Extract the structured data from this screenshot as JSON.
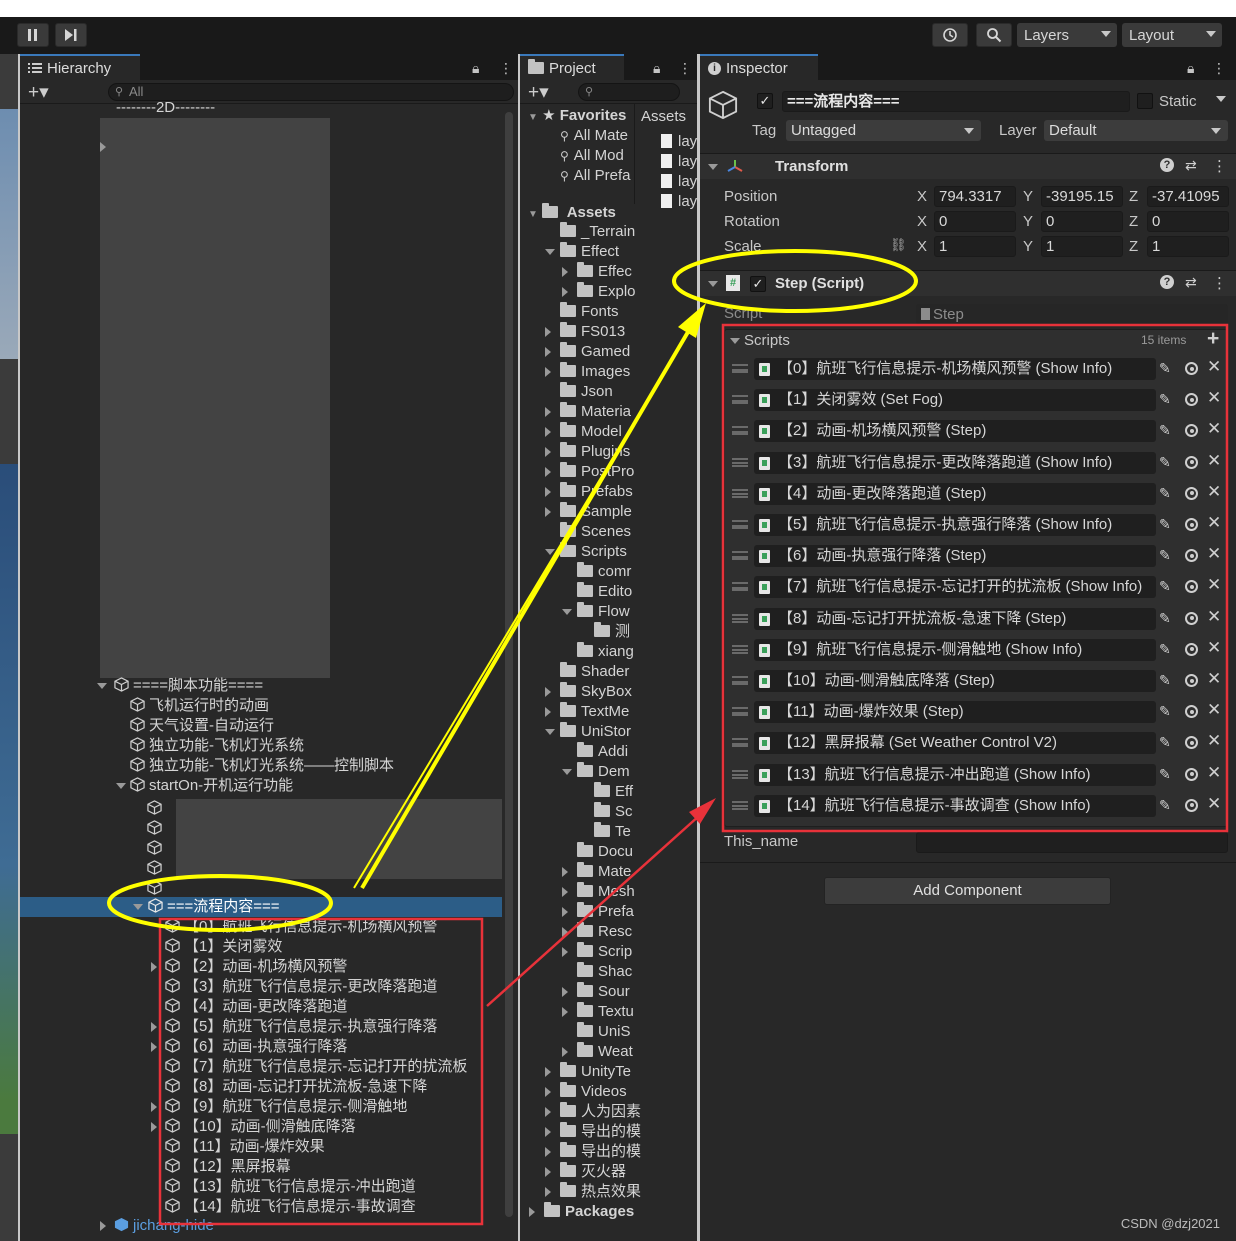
{
  "toolbar": {
    "layers_label": "Layers",
    "layout_label": "Layout"
  },
  "hierarchy": {
    "tab_label": "Hierarchy",
    "search_placeholder": "All",
    "top_row": "--------2D--------",
    "function_group": "====脚本功能====",
    "function_items": [
      "飞机运行时的动画",
      "天气设置-自动运行",
      "独立功能-飞机灯光系统",
      "独立功能-飞机灯光系统——控制脚本",
      "startOn-开机运行功能"
    ],
    "selected": "===流程内容===",
    "flow_children": [
      "【0】航班飞行信息提示-机场横风预警",
      "【1】关闭雾效",
      "【2】动画-机场横风预警",
      "【3】航班飞行信息提示-更改降落跑道",
      "【4】动画-更改降落跑道",
      "【5】航班飞行信息提示-执意强行降落",
      "【6】动画-执意强行降落",
      "【7】航班飞行信息提示-忘记打开的扰流板",
      "【8】动画-忘记打开扰流板-急速下降",
      "【9】航班飞行信息提示-侧滑触地",
      "【10】动画-侧滑触底降落",
      "【11】动画-爆炸效果",
      "【12】黑屏报幕",
      "【13】航班飞行信息提示-冲出跑道",
      "【14】航班飞行信息提示-事故调查"
    ],
    "bottom_item": "jichang-hide"
  },
  "project": {
    "tab_label": "Project",
    "favorites_label": "Favorites",
    "favorites": [
      "All Mate",
      "All Mod",
      "All Prefa"
    ],
    "assets_header": "Assets",
    "asset_files": [
      "lay",
      "lay",
      "lay",
      "lay"
    ],
    "assets_label": "Assets",
    "tree": [
      "_Terrain",
      "Effect",
      "Effec",
      "Explo",
      "Fonts",
      "FS013",
      "Gamed",
      "Images",
      "Json",
      "Materia",
      "Model",
      "Plugins",
      "PostPro",
      "Prefabs",
      "Sample",
      "Scenes",
      "Scripts",
      "comr",
      "Edito",
      "Flow",
      "测",
      "xiang",
      "Shader",
      "SkyBox",
      "TextMe",
      "UniStor",
      "Addi",
      "Dem",
      "Eff",
      "Sc",
      "Te",
      "Docu",
      "Mate",
      "Mesh",
      "Prefa",
      "Resc",
      "Scrip",
      "Shac",
      "Sour",
      "Textu",
      "UniS",
      "Weat",
      "UnityTe",
      "Videos",
      "人为因素",
      "导出的模",
      "导出的模",
      "灭火器",
      "热点效果",
      "Packages"
    ]
  },
  "inspector": {
    "tab_label": "Inspector",
    "object_name": "===流程内容===",
    "static_label": "Static",
    "tag_label": "Tag",
    "tag_value": "Untagged",
    "layer_label": "Layer",
    "layer_value": "Default",
    "transform": {
      "title": "Transform",
      "position_label": "Position",
      "rotation_label": "Rotation",
      "scale_label": "Scale",
      "position": {
        "x": "794.3317",
        "y": "-39195.15",
        "z": "-37.41095"
      },
      "rotation": {
        "x": "0",
        "y": "0",
        "z": "0"
      },
      "scale": {
        "x": "1",
        "y": "1",
        "z": "1"
      }
    },
    "step_component": {
      "title": "Step (Script)",
      "script_label": "Script",
      "script_value": "Step",
      "list_label": "Scripts",
      "list_count": "15 items",
      "items": [
        "【0】航班飞行信息提示-机场横风预警 (Show Info)",
        "【1】关闭雾效 (Set Fog)",
        "【2】动画-机场横风预警 (Step)",
        "【3】航班飞行信息提示-更改降落跑道 (Show Info)",
        "【4】动画-更改降落跑道 (Step)",
        "【5】航班飞行信息提示-执意强行降落 (Show Info)",
        "【6】动画-执意强行降落 (Step)",
        "【7】航班飞行信息提示-忘记打开的扰流板 (Show Info)",
        "【8】动画-忘记打开扰流板-急速下降 (Step)",
        "【9】航班飞行信息提示-侧滑触地 (Show Info)",
        "【10】动画-侧滑触底降落 (Step)",
        "【11】动画-爆炸效果 (Step)",
        "【12】黑屏报幕 (Set Weather Control V2)",
        "【13】航班飞行信息提示-冲出跑道 (Show Info)",
        "【14】航班飞行信息提示-事故调查 (Show Info)"
      ],
      "this_name_label": "This_name"
    },
    "add_component_label": "Add Component"
  },
  "watermark": "CSDN @dzj2021",
  "colors": {
    "annotation_yellow": "#ffff00",
    "annotation_red": "#e8323a",
    "selection_blue": "#2c5d87"
  }
}
